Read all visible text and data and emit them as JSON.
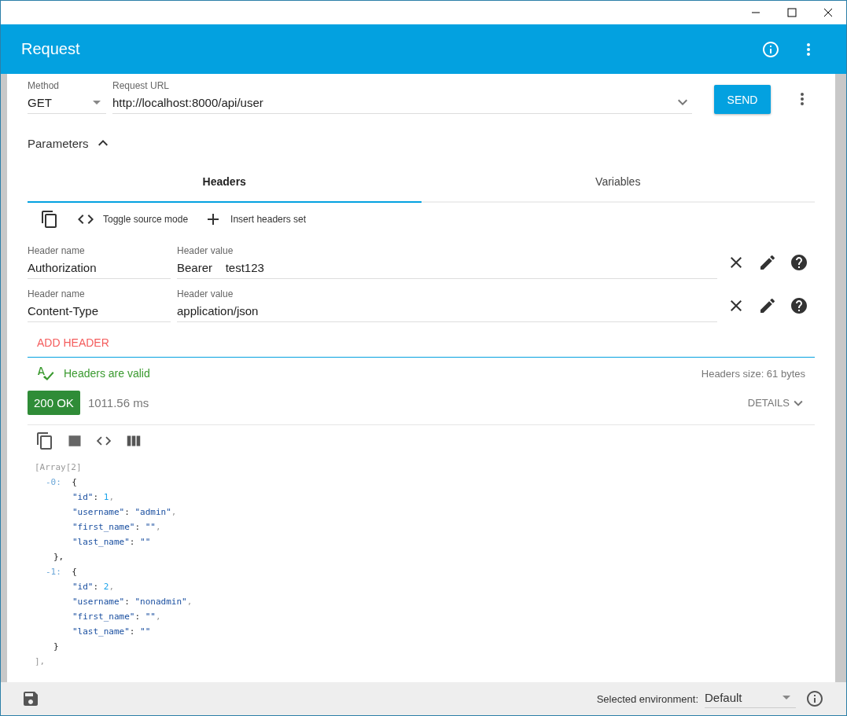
{
  "app_bar": {
    "title": "Request"
  },
  "request": {
    "method_label": "Method",
    "method": "GET",
    "url_label": "Request URL",
    "url": "http://localhost:8000/api/user",
    "send": "SEND"
  },
  "parameters": {
    "label": "Parameters",
    "expanded": true
  },
  "tabs": [
    {
      "label": "Headers",
      "selected": true
    },
    {
      "label": "Variables",
      "selected": false
    }
  ],
  "header_toolbar": [
    {
      "kind": "copy"
    },
    {
      "kind": "code",
      "label": "Toggle source mode"
    },
    {
      "kind": "add",
      "label": "Insert headers set"
    }
  ],
  "headers": [
    {
      "name_label": "Header name",
      "name": "Authorization",
      "value_label": "Header value",
      "value": "Bearer    test123"
    },
    {
      "name_label": "Header name",
      "name": "Content-Type",
      "value_label": "Header value",
      "value": "application/json"
    }
  ],
  "add_header": "ADD HEADER",
  "validation": {
    "message": "Headers are valid",
    "size": "Headers size: 61 bytes"
  },
  "response": {
    "status": "200 OK",
    "time": "1011.56 ms",
    "details": "DETAILS",
    "body": {
      "head": "[Array[2]",
      "items": [
        {
          "index": "-0:",
          "open": "{",
          "close": "},",
          "props": [
            {
              "key": "\"id\"",
              "sep": ": ",
              "value": "1",
              "kind": "number",
              "comma": ","
            },
            {
              "key": "\"username\"",
              "sep": ": ",
              "value": "\"admin\"",
              "kind": "string",
              "comma": ","
            },
            {
              "key": "\"first_name\"",
              "sep": ": ",
              "value": "\"\"",
              "kind": "string",
              "comma": ","
            },
            {
              "key": "\"last_name\"",
              "sep": ": ",
              "value": "\"\"",
              "kind": "string"
            }
          ]
        },
        {
          "index": "-1:",
          "open": "{",
          "close": "}",
          "props": [
            {
              "key": "\"id\"",
              "sep": ": ",
              "value": "2",
              "kind": "number",
              "comma": ","
            },
            {
              "key": "\"username\"",
              "sep": ": ",
              "value": "\"nonadmin\"",
              "kind": "string",
              "comma": ","
            },
            {
              "key": "\"first_name\"",
              "sep": ": ",
              "value": "\"\"",
              "kind": "string",
              "comma": ","
            },
            {
              "key": "\"last_name\"",
              "sep": ": ",
              "value": "\"\"",
              "kind": "string"
            }
          ]
        }
      ],
      "tail": "],"
    }
  },
  "footer": {
    "env_label": "Selected environment:",
    "env": "Default"
  }
}
